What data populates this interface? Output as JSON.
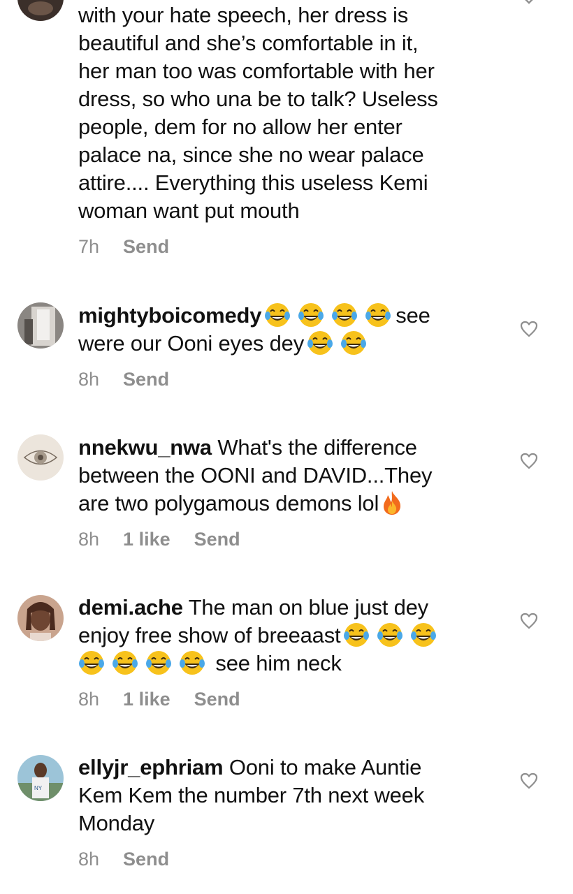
{
  "comments": [
    {
      "username": "",
      "text_lines": [
        "with your hate speech, her dress is",
        "beautiful and she’s comfortable in it,",
        "her man too was comfortable with her",
        "dress, so who una be to talk?  Useless",
        "people, dem for no allow her enter",
        "palace na, since she no wear palace",
        "attire.... Everything this useless Kemi",
        "woman want put mouth"
      ],
      "time": "7h",
      "likes": "",
      "reply": "Send"
    },
    {
      "username": "mightyboicomedy",
      "line1_after_emoji": "see",
      "line2": "were our Ooni eyes  dey",
      "time": "8h",
      "likes": "",
      "reply": "Send"
    },
    {
      "username": "nnekwu_nwa",
      "line1_rest": "What's the difference",
      "line2": "between the OONI and DAVID...They",
      "line3": "are two polygamous demons lol",
      "time": "8h",
      "likes": "1 like",
      "reply": "Send"
    },
    {
      "username": "demi.ache",
      "line1_rest": "The man on blue just dey",
      "line2": "enjoy free show of breeaast",
      "line3_after_emoji": "see him neck",
      "time": "8h",
      "likes": "1 like",
      "reply": "Send"
    },
    {
      "username": "ellyjr_ephriam",
      "line1_rest": "Ooni to make Auntie",
      "line2": "Kem Kem the number 7th next week",
      "line3": "Monday",
      "time": "8h",
      "likes": "",
      "reply": "Send"
    }
  ],
  "icons": {
    "laugh_emoji": "face-with-tears-of-joy-icon",
    "fire_emoji": "fire-icon",
    "heart": "heart-outline-icon",
    "chevron": "chevron-down-icon"
  },
  "colors": {
    "text": "#111111",
    "meta": "#8e8e8e",
    "emoji_face": "#f7c21c",
    "emoji_tears": "#4aa8e8",
    "fire": "#f26b1d"
  }
}
